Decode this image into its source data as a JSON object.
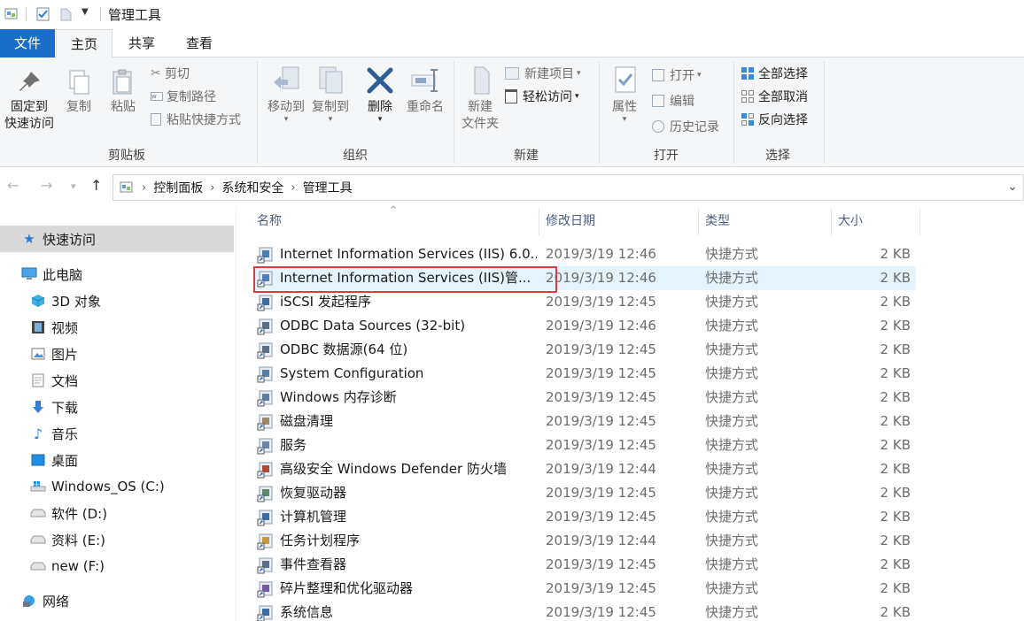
{
  "window": {
    "title": "管理工具"
  },
  "ribbon_tabs": [
    "文件",
    "主页",
    "共享",
    "查看"
  ],
  "ribbon": {
    "clipboard": {
      "label": "剪贴板",
      "pin": "固定到",
      "pin2": "快速访问",
      "copy": "复制",
      "paste": "粘贴",
      "cut": "剪切",
      "copy_path": "复制路径",
      "paste_shortcut": "粘贴快捷方式"
    },
    "organize": {
      "label": "组织",
      "move_to": "移动到",
      "copy_to": "复制到",
      "delete": "删除",
      "rename": "重命名"
    },
    "new": {
      "label": "新建",
      "new_folder": "新建",
      "new_folder2": "文件夹",
      "new_item": "新建项目",
      "easy_access": "轻松访问"
    },
    "open": {
      "label": "打开",
      "properties": "属性",
      "open": "打开",
      "edit": "编辑",
      "history": "历史记录"
    },
    "select": {
      "label": "选择",
      "select_all": "全部选择",
      "select_none": "全部取消",
      "invert": "反向选择"
    }
  },
  "address": {
    "crumbs": [
      "控制面板",
      "系统和安全",
      "管理工具"
    ]
  },
  "nav": {
    "quick_access": "快速访问",
    "this_pc": "此电脑",
    "items": [
      "3D 对象",
      "视频",
      "图片",
      "文档",
      "下载",
      "音乐",
      "桌面",
      "Windows_OS (C:)",
      "软件 (D:)",
      "资料 (E:)",
      "new (F:)"
    ],
    "network": "网络"
  },
  "columns": {
    "name": "名称",
    "date": "修改日期",
    "type": "类型",
    "size": "大小"
  },
  "files": [
    {
      "name": "Internet Information Services (IIS) 6.0...",
      "date": "2019/3/19 12:46",
      "type": "快捷方式",
      "size": "2 KB"
    },
    {
      "name": "Internet Information Services (IIS)管...",
      "date": "2019/3/19 12:46",
      "type": "快捷方式",
      "size": "2 KB"
    },
    {
      "name": "iSCSI 发起程序",
      "date": "2019/3/19 12:45",
      "type": "快捷方式",
      "size": "2 KB"
    },
    {
      "name": "ODBC Data Sources (32-bit)",
      "date": "2019/3/19 12:46",
      "type": "快捷方式",
      "size": "2 KB"
    },
    {
      "name": "ODBC 数据源(64 位)",
      "date": "2019/3/19 12:45",
      "type": "快捷方式",
      "size": "2 KB"
    },
    {
      "name": "System Configuration",
      "date": "2019/3/19 12:45",
      "type": "快捷方式",
      "size": "2 KB"
    },
    {
      "name": "Windows 内存诊断",
      "date": "2019/3/19 12:45",
      "type": "快捷方式",
      "size": "2 KB"
    },
    {
      "name": "磁盘清理",
      "date": "2019/3/19 12:45",
      "type": "快捷方式",
      "size": "2 KB"
    },
    {
      "name": "服务",
      "date": "2019/3/19 12:45",
      "type": "快捷方式",
      "size": "2 KB"
    },
    {
      "name": "高级安全 Windows Defender 防火墙",
      "date": "2019/3/19 12:44",
      "type": "快捷方式",
      "size": "2 KB"
    },
    {
      "name": "恢复驱动器",
      "date": "2019/3/19 12:45",
      "type": "快捷方式",
      "size": "2 KB"
    },
    {
      "name": "计算机管理",
      "date": "2019/3/19 12:45",
      "type": "快捷方式",
      "size": "2 KB"
    },
    {
      "name": "任务计划程序",
      "date": "2019/3/19 12:44",
      "type": "快捷方式",
      "size": "2 KB"
    },
    {
      "name": "事件查看器",
      "date": "2019/3/19 12:45",
      "type": "快捷方式",
      "size": "2 KB"
    },
    {
      "name": "碎片整理和优化驱动器",
      "date": "2019/3/19 12:45",
      "type": "快捷方式",
      "size": "2 KB"
    },
    {
      "name": "系统信息",
      "date": "2019/3/19 12:45",
      "type": "快捷方式",
      "size": "2 KB"
    }
  ],
  "colors": {
    "file_tab": "#1a6dc8",
    "hover_row": "#e5f3ff",
    "highlight": "#e0393e"
  }
}
